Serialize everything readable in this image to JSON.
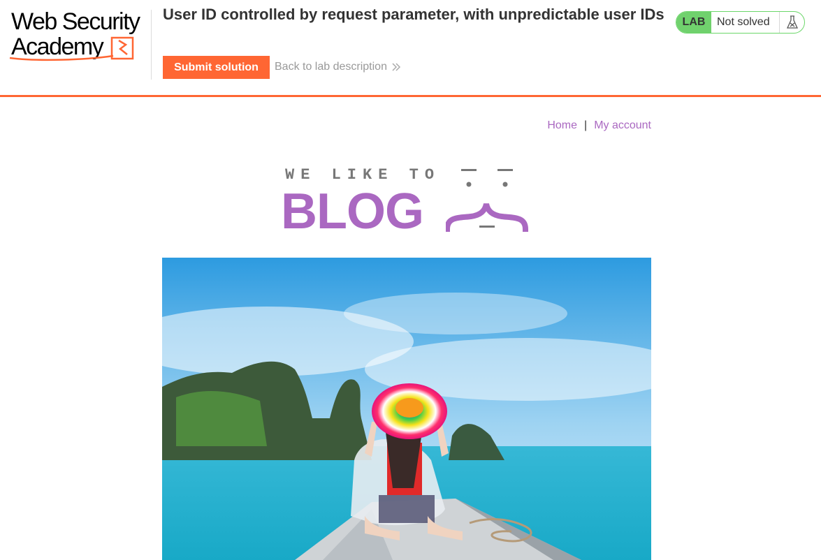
{
  "lab_header": {
    "logo": {
      "line1": "Web Security",
      "line2": "Academy"
    },
    "title": "User ID controlled by request parameter, with unpredictable user IDs",
    "submit_label": "Submit solution",
    "back_label": "Back to lab description",
    "status": {
      "badge": "LAB",
      "text": "Not solved",
      "icon": "flask-icon"
    }
  },
  "nav": {
    "home": "Home",
    "separator": "|",
    "account": "My account"
  },
  "banner": {
    "tagline": "WE LIKE TO",
    "word": "BLOG"
  },
  "hero_image": {
    "description_icon": "travel-photo"
  },
  "colors": {
    "accent": "#ff6633",
    "blog_purple": "#aa68c1",
    "status_green": "#70d16d"
  }
}
